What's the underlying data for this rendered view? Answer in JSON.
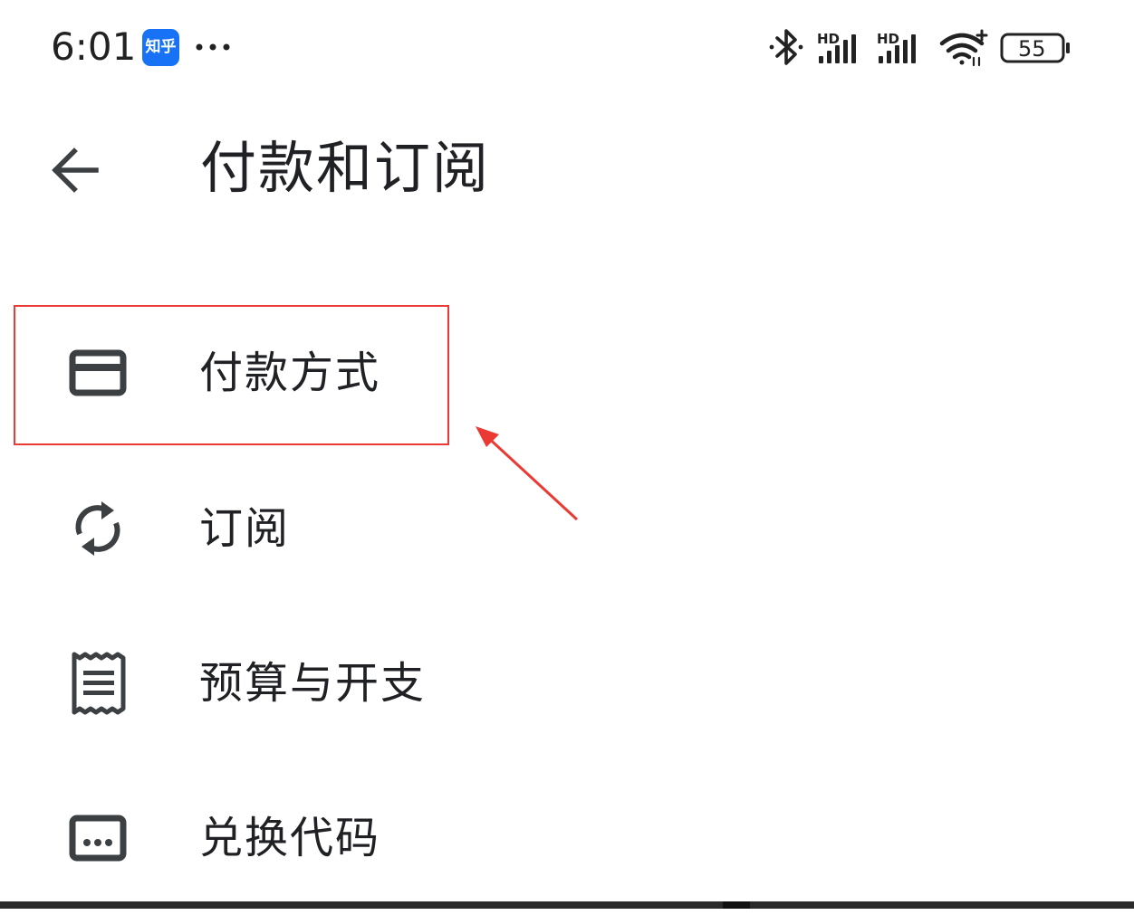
{
  "status_bar": {
    "time": "6:01",
    "app_badge_label": "知乎",
    "app_badge_color": "#1772f6",
    "network_label_1": "HD",
    "network_label_2": "HD",
    "battery_level": "55"
  },
  "app_bar": {
    "title": "付款和订阅",
    "back_icon": "arrow-left-icon"
  },
  "menu": {
    "items": [
      {
        "label": "付款方式",
        "icon": "credit-card-icon"
      },
      {
        "label": "订阅",
        "icon": "sync-icon"
      },
      {
        "label": "预算与开支",
        "icon": "receipt-icon"
      },
      {
        "label": "兑换代码",
        "icon": "redeem-code-icon"
      }
    ]
  },
  "annotation": {
    "color": "#ea3a33"
  }
}
